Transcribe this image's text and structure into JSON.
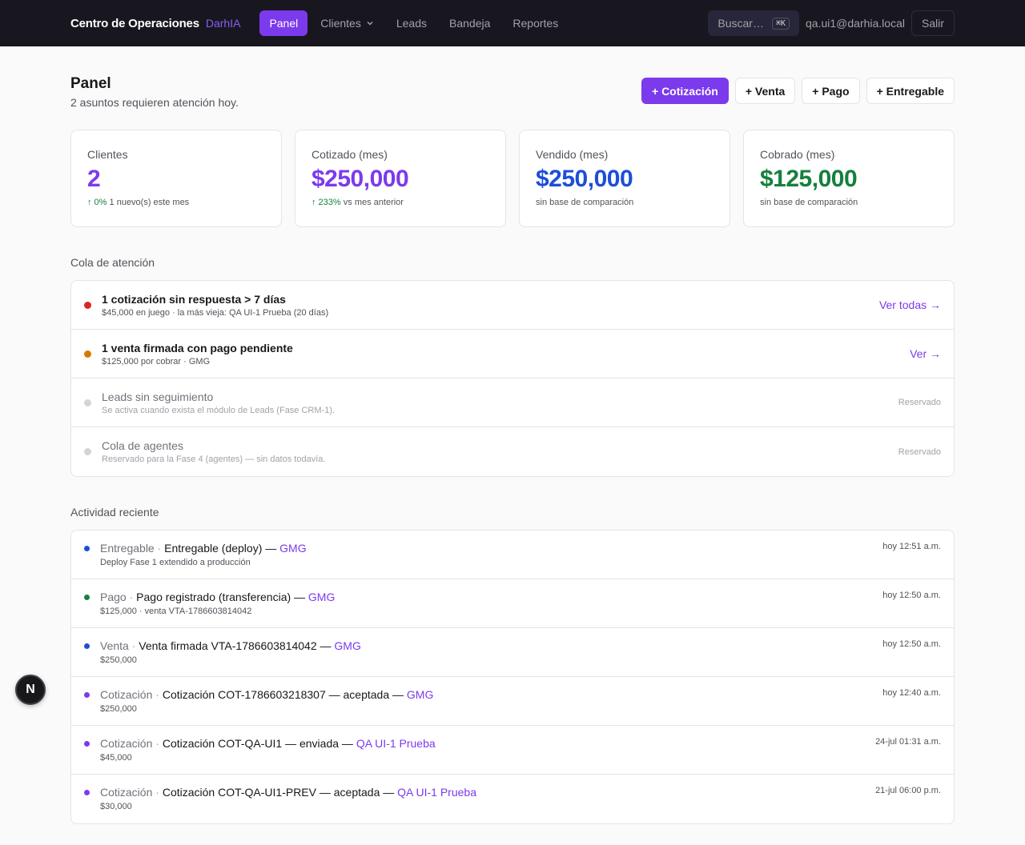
{
  "nav": {
    "brand": "Centro de Operaciones",
    "brand_tag": "DarhIA",
    "items": [
      {
        "label": "Panel",
        "active": true
      },
      {
        "label": "Clientes",
        "has_dropdown": true
      },
      {
        "label": "Leads"
      },
      {
        "label": "Bandeja"
      },
      {
        "label": "Reportes"
      }
    ],
    "search_placeholder": "Buscar…",
    "search_shortcut": "⌘K",
    "user_email": "qa.ui1@darhia.local",
    "logout_label": "Salir"
  },
  "header": {
    "title": "Panel",
    "subtitle": "2 asuntos requieren atención hoy.",
    "actions": [
      "+ Cotización",
      "+ Venta",
      "+ Pago",
      "+ Entregable"
    ]
  },
  "kpis": [
    {
      "label": "Clientes",
      "value": "2",
      "trend": "↑ 0%",
      "note": "1 nuevo(s) este mes",
      "color": "#7c3aed"
    },
    {
      "label": "Cotizado (mes)",
      "value": "$250,000",
      "trend": "↑ 233%",
      "note": "vs mes anterior",
      "color": "#7c3aed"
    },
    {
      "label": "Vendido (mes)",
      "value": "$250,000",
      "trend": "",
      "note": "sin base de comparación",
      "color": "#1d4ed8"
    },
    {
      "label": "Cobrado (mes)",
      "value": "$125,000",
      "trend": "",
      "note": "sin base de comparación",
      "color": "#15803d"
    }
  ],
  "queue": {
    "title": "Cola de atención",
    "items": [
      {
        "title": "1 cotización sin respuesta > 7 días",
        "sub": "$45,000 en juego · la más vieja: QA UI-1 Prueba (20 días)",
        "action": "Ver todas →",
        "status_color": "#dc2626",
        "reserved": false
      },
      {
        "title": "1 venta firmada con pago pendiente",
        "sub": "$125,000 por cobrar · GMG",
        "action": "Ver →",
        "status_color": "#d97706",
        "reserved": false
      },
      {
        "title": "Leads sin seguimiento",
        "sub": "Se activa cuando exista el módulo de Leads (Fase CRM-1).",
        "action": "Reservado",
        "status_color": "#d4d4d8",
        "reserved": true
      },
      {
        "title": "Cola de agentes",
        "sub": "Reservado para la Fase 4 (agentes) — sin datos todavía.",
        "action": "Reservado",
        "status_color": "#d4d4d8",
        "reserved": true
      }
    ]
  },
  "activity": {
    "title": "Actividad reciente",
    "items": [
      {
        "type": "Entregable",
        "desc": "Entregable (deploy) —",
        "client": "GMG",
        "sub": "Deploy Fase 1 extendido a producción",
        "time": "hoy 12:51 a.m.",
        "dot_color": "#1d4ed8"
      },
      {
        "type": "Pago",
        "desc": "Pago registrado (transferencia) —",
        "client": "GMG",
        "sub": "$125,000 · venta VTA-1786603814042",
        "time": "hoy 12:50 a.m.",
        "dot_color": "#15803d"
      },
      {
        "type": "Venta",
        "desc": "Venta firmada VTA-1786603814042 —",
        "client": "GMG",
        "sub": "$250,000",
        "time": "hoy 12:50 a.m.",
        "dot_color": "#1d4ed8"
      },
      {
        "type": "Cotización",
        "desc": "Cotización COT-1786603218307 — aceptada —",
        "client": "GMG",
        "sub": "$250,000",
        "time": "hoy 12:40 a.m.",
        "dot_color": "#7c3aed"
      },
      {
        "type": "Cotización",
        "desc": "Cotización COT-QA-UI1 — enviada —",
        "client": "QA UI-1 Prueba",
        "sub": "$45,000",
        "time": "24-jul 01:31 a.m.",
        "dot_color": "#7c3aed"
      },
      {
        "type": "Cotización",
        "desc": "Cotización COT-QA-UI1-PREV — aceptada —",
        "client": "QA UI-1 Prueba",
        "sub": "$30,000",
        "time": "21-jul 06:00 p.m.",
        "dot_color": "#7c3aed"
      }
    ]
  },
  "fab": {
    "label": "N"
  }
}
